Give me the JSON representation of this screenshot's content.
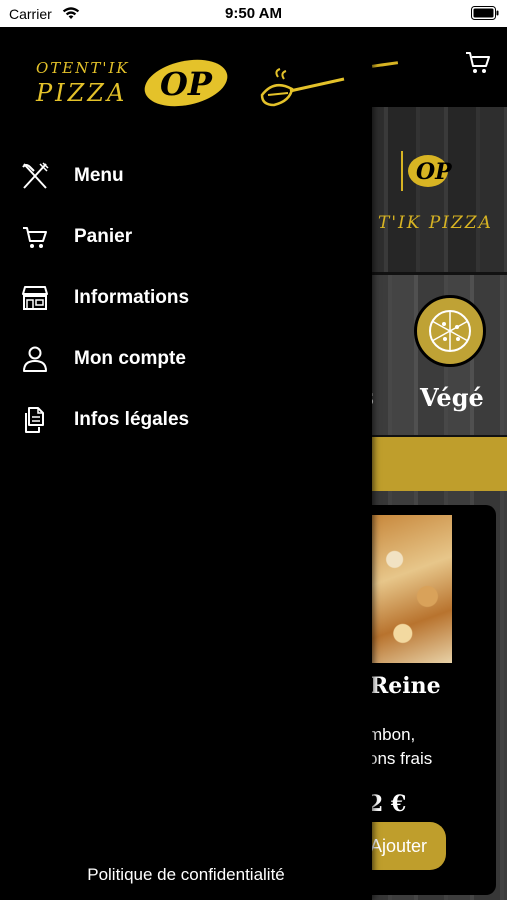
{
  "status_bar": {
    "carrier": "Carrier",
    "time": "9:50 AM"
  },
  "drawer": {
    "logo": {
      "line1": "OTENT'IK",
      "line2": "PIZZA",
      "mark": "OP"
    },
    "menu_items": [
      {
        "label": "Menu",
        "icon": "fork-knife-icon"
      },
      {
        "label": "Panier",
        "icon": "cart-icon"
      },
      {
        "label": "Informations",
        "icon": "storefront-icon"
      },
      {
        "label": "Mon compte",
        "icon": "person-icon"
      },
      {
        "label": "Infos légales",
        "icon": "documents-icon"
      }
    ],
    "privacy_link": "Politique de confidentialité"
  },
  "background": {
    "hero_brand": "T'IK PIZZA",
    "category_partial": "s",
    "category_label": "Végé",
    "card_title": "Reine",
    "card_desc_line1": "mbon,",
    "card_desc_line2": "ons frais",
    "card_price": "2 €",
    "card_button": "Ajouter"
  },
  "colors": {
    "accent_gold": "#e4c22a",
    "button_gold": "#bf9e2c",
    "drawer_bg": "#000000"
  }
}
